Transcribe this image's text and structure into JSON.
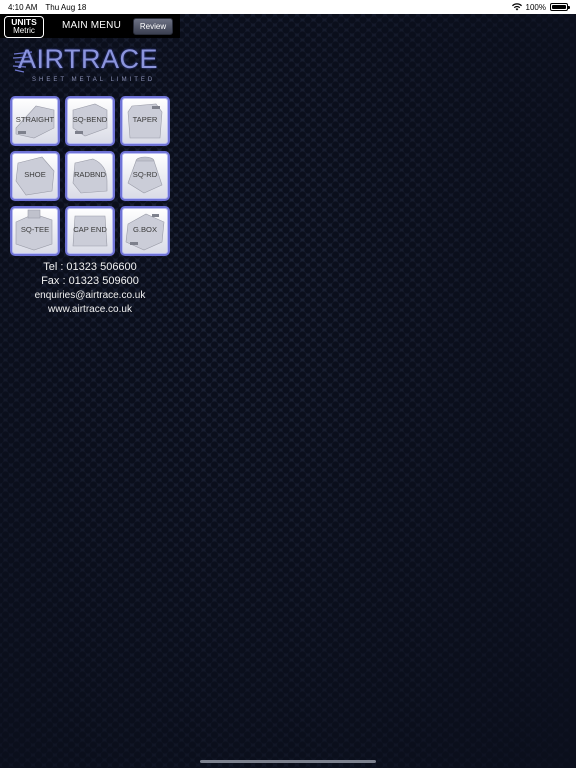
{
  "status_bar": {
    "time": "4:10 AM",
    "date": "Thu Aug 18",
    "battery": "100%",
    "battery_level": 1.0
  },
  "nav": {
    "units_label": "UNITS",
    "units_value": "Metric",
    "title": "MAIN MENU",
    "review_label": "Review"
  },
  "logo": {
    "wordmark": "AIRTRACE",
    "subtitle": "SHEET METAL LIMITED"
  },
  "tiles": [
    {
      "label": "STRAIGHT"
    },
    {
      "label": "SQ-BEND"
    },
    {
      "label": "TAPER"
    },
    {
      "label": "SHOE"
    },
    {
      "label": "RADBND"
    },
    {
      "label": "SQ-RD"
    },
    {
      "label": "SQ-TEE"
    },
    {
      "label": "CAP END"
    },
    {
      "label": "G.BOX"
    }
  ],
  "contact": {
    "tel": "Tel : 01323 506600",
    "fax": "Fax : 01323 509600",
    "email": "enquiries@airtrace.co.uk",
    "website": "www.airtrace.co.uk"
  },
  "colors": {
    "tile_border": "#6f73d6",
    "logo": "#8c95dd",
    "background": "#151a2b"
  }
}
